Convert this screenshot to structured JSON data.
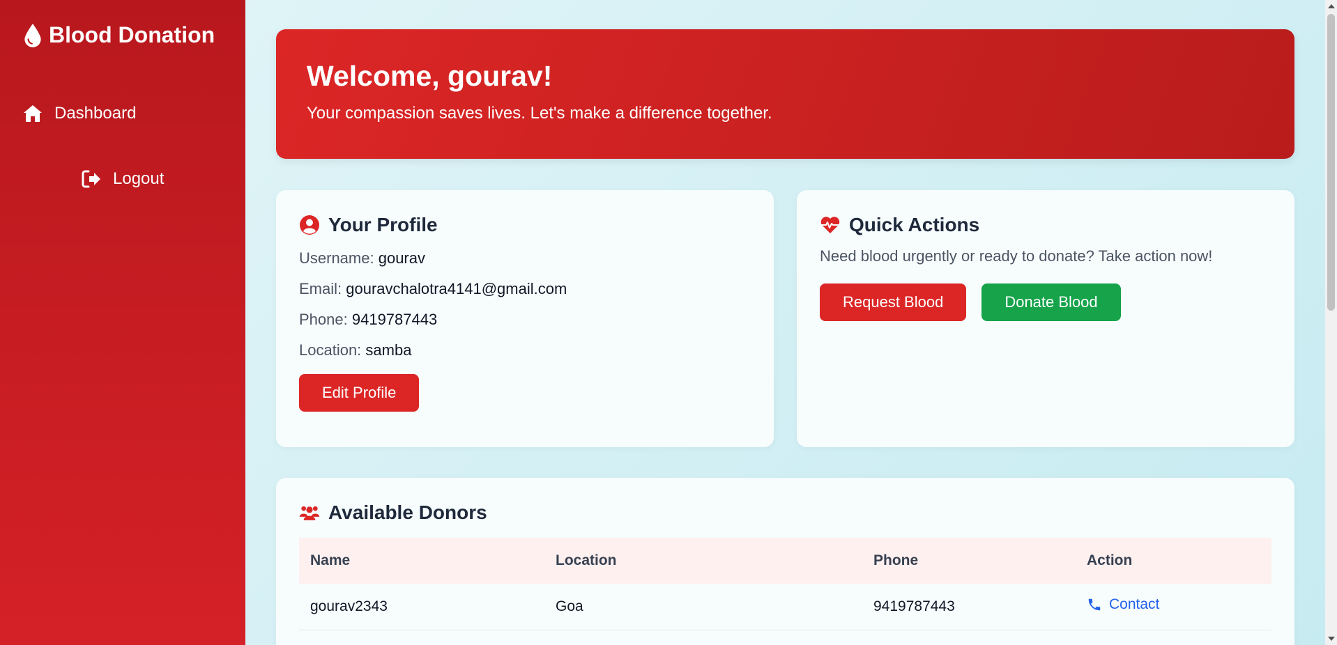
{
  "sidebar": {
    "brand": "Blood Donation",
    "brand_icon": "blood-drop-icon",
    "items": [
      {
        "label": "Dashboard",
        "icon": "home-icon"
      },
      {
        "label": "Logout",
        "icon": "logout-icon"
      }
    ]
  },
  "welcome": {
    "title": "Welcome, gourav!",
    "subtitle": "Your compassion saves lives. Let's make a difference together."
  },
  "profile": {
    "title": "Your Profile",
    "icon": "user-circle-icon",
    "fields": [
      {
        "label": "Username:",
        "value": "gourav"
      },
      {
        "label": "Email:",
        "value": "gouravchalotra4141@gmail.com"
      },
      {
        "label": "Phone:",
        "value": "9419787443"
      },
      {
        "label": "Location:",
        "value": "samba"
      }
    ],
    "edit_label": "Edit Profile"
  },
  "quick_actions": {
    "title": "Quick Actions",
    "icon": "heart-pulse-icon",
    "text": "Need blood urgently or ready to donate? Take action now!",
    "request_label": "Request Blood",
    "donate_label": "Donate Blood"
  },
  "donors": {
    "title": "Available Donors",
    "icon": "users-icon",
    "columns": [
      "Name",
      "Location",
      "Phone",
      "Action"
    ],
    "rows": [
      {
        "name": "gourav2343",
        "location": "Goa",
        "phone": "9419787443",
        "action": "Contact"
      }
    ]
  },
  "colors": {
    "primary_red": "#dc2626",
    "sidebar_red": "#b8181d",
    "green": "#16a34a",
    "link_blue": "#2563eb"
  }
}
